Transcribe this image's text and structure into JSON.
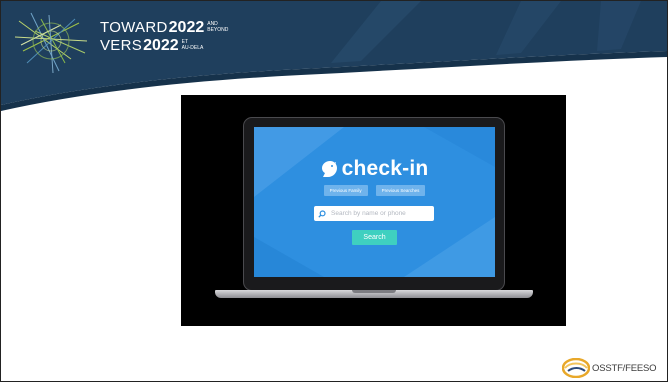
{
  "header": {
    "line1_word": "TOWARD",
    "line1_year": "2022",
    "line1_sub_top": "AND",
    "line1_sub_bottom": "BEYOND",
    "line2_word": "VERS",
    "line2_year": "2022",
    "line2_sub_top": "ET",
    "line2_sub_bottom": "AU-DELA",
    "banner_color": "#1f3f5d"
  },
  "video": {
    "app_name": "check-in",
    "previous_buttons": [
      "Previous Family",
      "Previous Searches"
    ],
    "search_placeholder": "Search by name or phone",
    "search_button_label": "Search",
    "screen_color": "#2e8fe0",
    "accent_color": "#3fd0c0"
  },
  "footer": {
    "org_name": "OSSTF/FEESO"
  }
}
